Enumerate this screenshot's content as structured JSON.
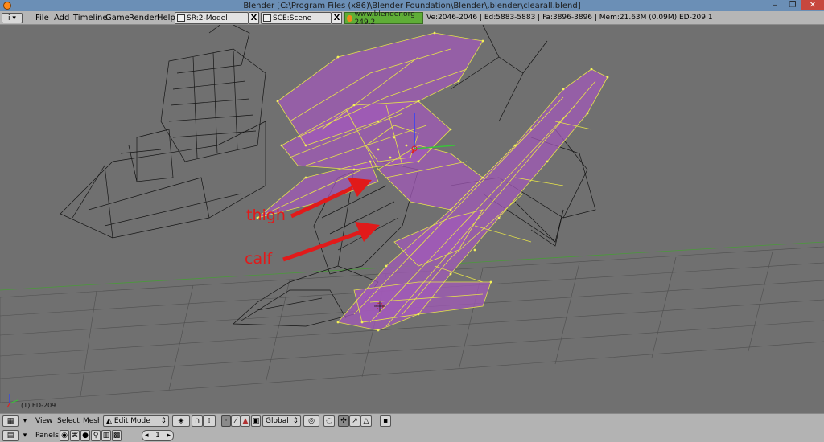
{
  "window": {
    "title": "Blender [C:\\Program Files (x86)\\Blender Foundation\\Blender\\.blender\\clearall.blend]",
    "minimize_glyph": "–",
    "maximize_glyph": "❐",
    "close_glyph": "✕"
  },
  "menu": {
    "window_type_icon": "info-icon",
    "items": [
      "File",
      "Add",
      "Timeline",
      "Game",
      "Render",
      "Help"
    ],
    "screen_field": "SR:2-Model",
    "scene_field": "SCE:Scene",
    "close_glyph": "X",
    "url": "www.blender.org 249.2",
    "stats": "Ve:2046-2046 | Ed:5883-5883 | Fa:3896-3896 | Mem:21.63M (0.09M) ED-209 1"
  },
  "viewport": {
    "annotations": [
      "thigh",
      "calf"
    ],
    "object_info": "(1) ED-209 1",
    "annotation_color": "#e11a1a",
    "selection_color": "#e6e34a",
    "face_color": "#a25ab8"
  },
  "view3d_header": {
    "window_type_icon": "grid-icon",
    "menus": [
      "View",
      "Select",
      "Mesh"
    ],
    "mode": "Edit Mode",
    "orientation": "Global",
    "pivot_icon": "pivot-icon",
    "layer_icon": "layer-icon"
  },
  "buttons_header": {
    "panels_label": "Panels",
    "frame_value": "1"
  }
}
